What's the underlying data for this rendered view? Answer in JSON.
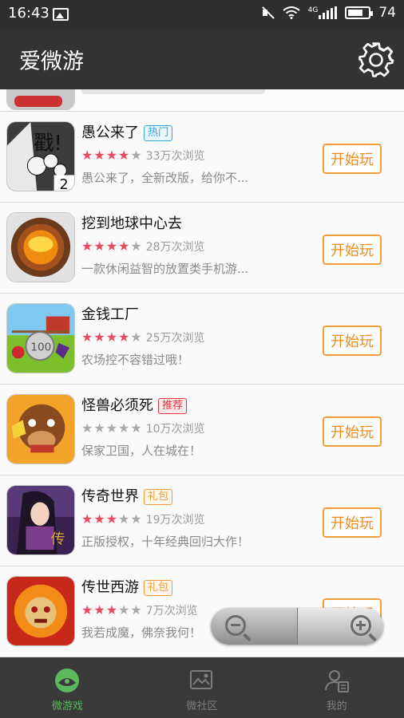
{
  "status_bar": {
    "time": "16:43",
    "network": "4G",
    "battery": "74",
    "battery_level": 0.74
  },
  "header": {
    "title": "爱微游",
    "settings_icon": "gear-icon"
  },
  "games": [
    {
      "name": "愚公来了",
      "tag": "热门",
      "tag_color": "#35a6e0",
      "rating": 4,
      "views": "33万次浏览",
      "desc": "愚公来了，全新改版，给你不...",
      "button": "开始玩"
    },
    {
      "name": "挖到地球中心去",
      "tag": "",
      "tag_color": "",
      "rating": 4,
      "views": "28万次浏览",
      "desc": "一款休闲益智的放置类手机游...",
      "button": "开始玩"
    },
    {
      "name": "金钱工厂",
      "tag": "",
      "tag_color": "",
      "rating": 4,
      "views": "25万次浏览",
      "desc": "农场控不容错过哦！",
      "button": "开始玩"
    },
    {
      "name": "怪兽必须死",
      "tag": "推荐",
      "tag_color": "#e8313d",
      "rating": 0,
      "views": "10万次浏览",
      "desc": "保家卫国，人在城在！",
      "button": "开始玩"
    },
    {
      "name": "传奇世界",
      "tag": "礼包",
      "tag_color": "#f29a3a",
      "rating": 3,
      "views": "19万次浏览",
      "desc": "正版授权，十年经典回归大作！",
      "button": "开始玩"
    },
    {
      "name": "传世西游",
      "tag": "礼包",
      "tag_color": "#f29a3a",
      "rating": 3,
      "views": "7万次浏览",
      "desc": "我若成魔，佛奈我何！",
      "button": "开始玩"
    }
  ],
  "zoom": {
    "out_icon": "zoom-out-icon",
    "in_icon": "zoom-in-icon"
  },
  "bottom_nav": [
    {
      "label": "微游戏",
      "icon": "game-icon",
      "active": true
    },
    {
      "label": "微社区",
      "icon": "community-icon",
      "active": false
    },
    {
      "label": "我的",
      "icon": "profile-icon",
      "active": false
    }
  ],
  "colors": {
    "accent": "#f39c3a",
    "header": "#333333",
    "nav_active": "#5cb85c"
  }
}
